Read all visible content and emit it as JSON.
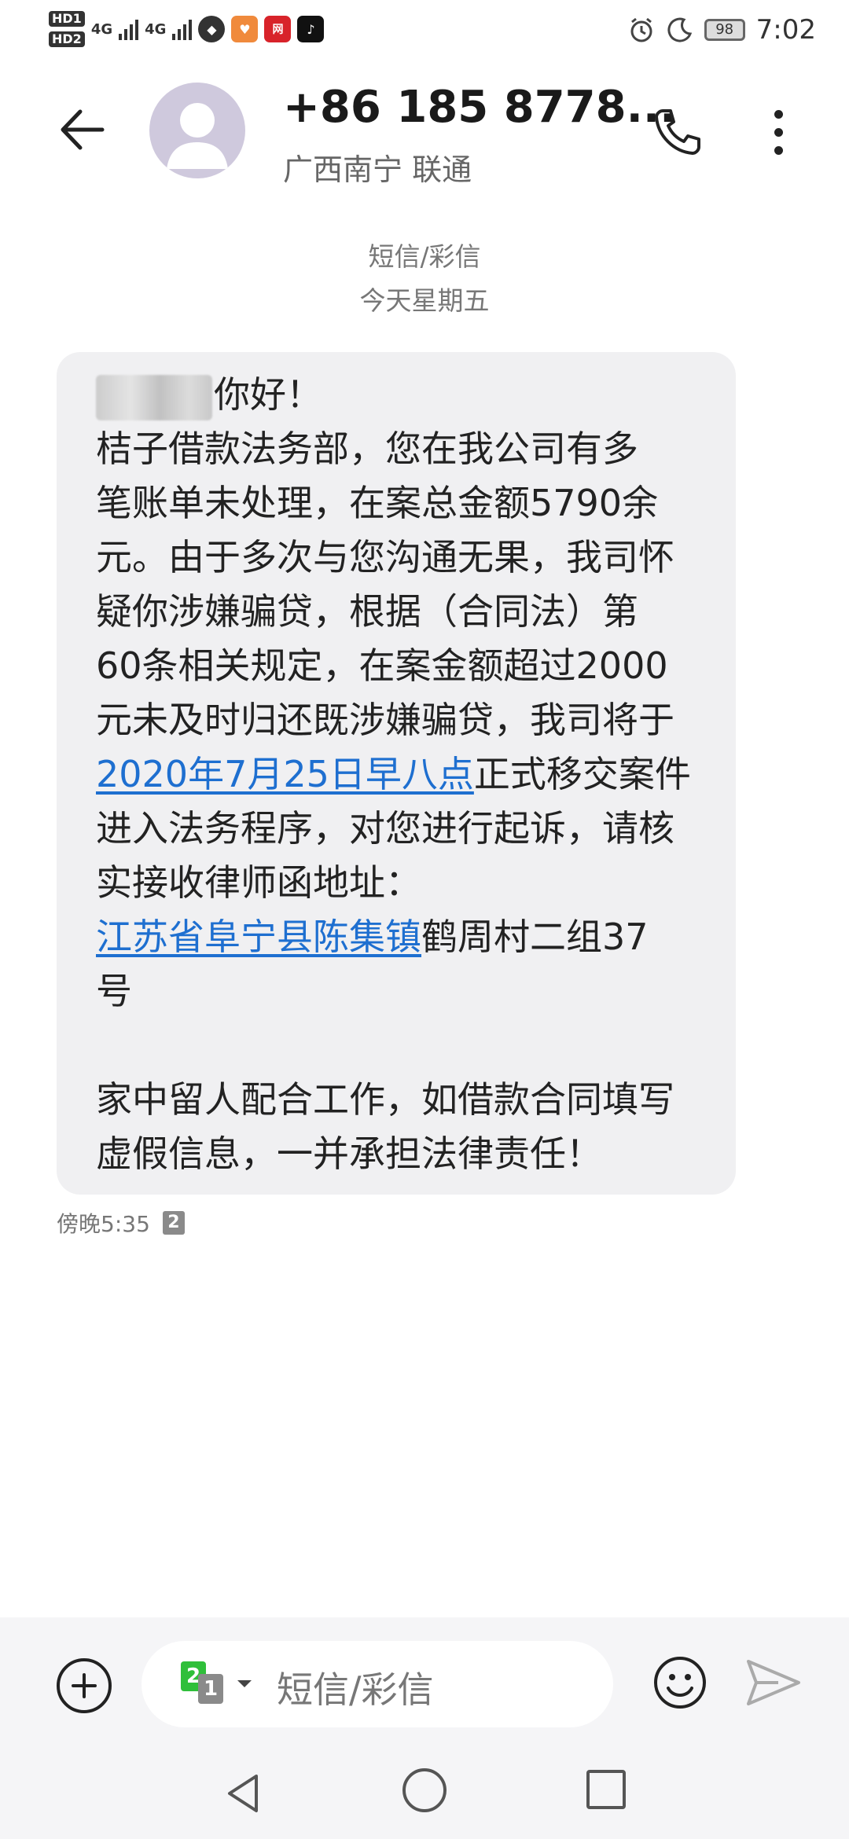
{
  "status_bar": {
    "hd1": "HD1",
    "hd2": "HD2",
    "net1": "4G",
    "net2": "4G",
    "app_icons": [
      "qq-icon",
      "health-app-icon",
      "netease-news-icon",
      "tiktok-icon"
    ],
    "battery": "98",
    "time": "7:02"
  },
  "header": {
    "contact_number": "+86 185 8778...",
    "contact_location": "广西南宁 联通"
  },
  "conversation": {
    "type_label": "短信/彩信",
    "date_label": "今天星期五"
  },
  "message": {
    "greeting_visible": "你好！",
    "p1": "桔子借款法务部，您在我公司有多",
    "p2": "笔账单未处理，在案总金额5790余",
    "p3": "元。由于多次与您沟通无果，我司怀",
    "p4": "疑你涉嫌骗贷，根据（合同法）第",
    "p5": "60条相关规定，在案金额超过2000",
    "p6": "元未及时归还既涉嫌骗贷，我司将于",
    "link_date": "2020年7月25日早八点",
    "p7_rest": "正式移交案件",
    "p8": "进入法务程序，对您进行起诉，请核",
    "p9": "实接收律师函地址：",
    "link_address": "江苏省阜宁县陈集镇",
    "p10_rest": "鹤周村二组37",
    "p11": "号",
    "p12": "家中留人配合工作，如借款合同填写",
    "p13": "虚假信息，一并承担法律责任！",
    "time": "傍晚5:35",
    "sim": "2",
    "link_color": "#1e6fd0"
  },
  "input": {
    "placeholder": "短信/彩信",
    "sim_primary": "2",
    "sim_secondary": "1"
  }
}
